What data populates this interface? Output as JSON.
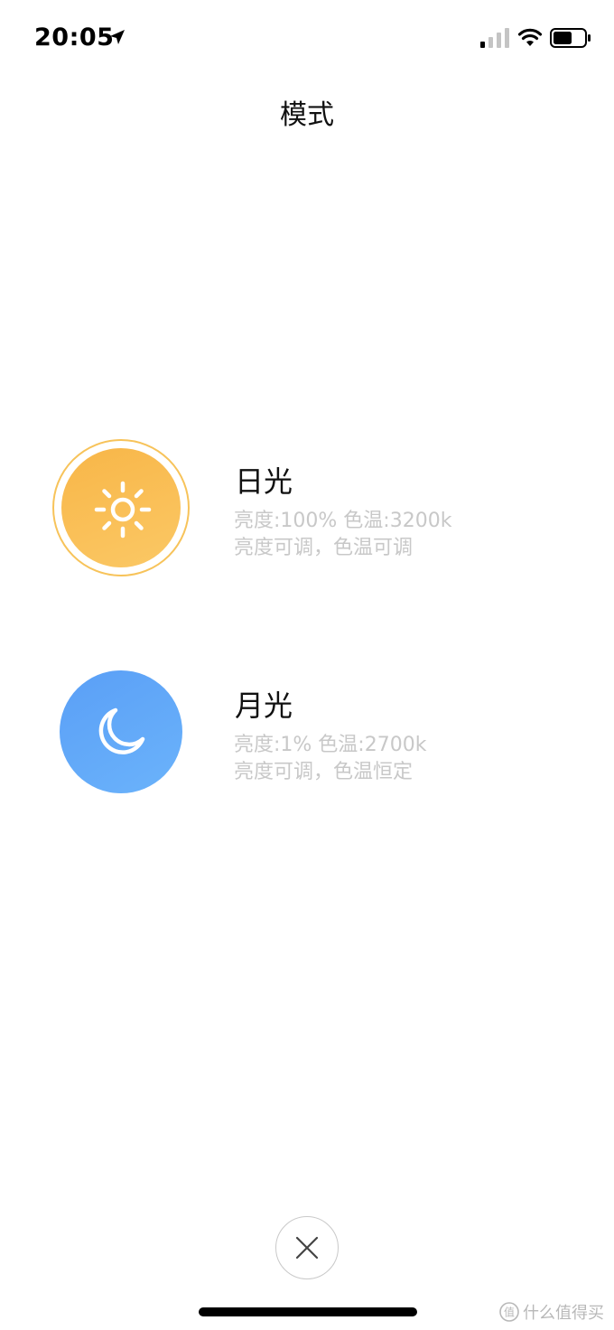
{
  "status_bar": {
    "time": "20:05",
    "icons": [
      "location-arrow-icon",
      "cellular-signal-icon",
      "wifi-icon",
      "battery-icon"
    ]
  },
  "header": {
    "title": "模式"
  },
  "modes": [
    {
      "name": "日光",
      "details_line1": "亮度:100%  色温:3200k",
      "details_line2": "亮度可调，色温可调",
      "icon": "sun-icon",
      "color": "#f9bd55",
      "selected": true
    },
    {
      "name": "月光",
      "details_line1": "亮度:1%  色温:2700k",
      "details_line2": "亮度可调，色温恒定",
      "icon": "moon-icon",
      "color": "#62a9f8",
      "selected": false
    }
  ],
  "footer": {
    "close_icon": "close-icon"
  },
  "watermark": {
    "text": "什么值得买"
  }
}
